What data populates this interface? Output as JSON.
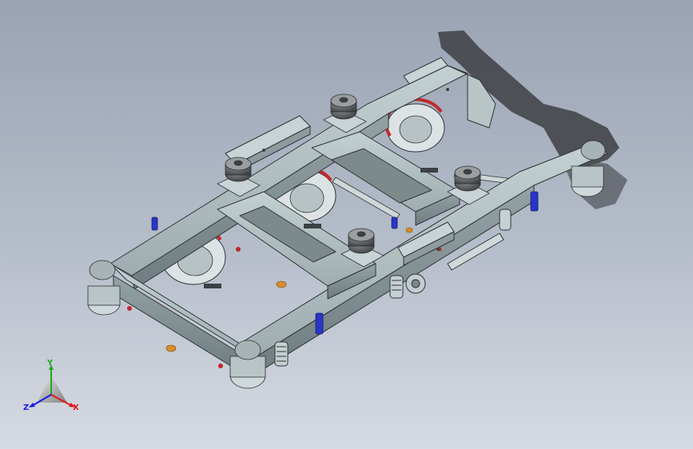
{
  "viewport": {
    "background_top": "#9aa3b4",
    "background_bottom": "#d6dae2",
    "model": "bogie-3d-model"
  },
  "triad": {
    "x_label": "X",
    "y_label": "Y",
    "z_label": "Z",
    "x_color": "#e01818",
    "y_color": "#1fa81f",
    "z_color": "#1a1ae0"
  },
  "colors": {
    "frame": "#aebdbf",
    "frame_shade": "#8a999c",
    "frame_dark": "#6c7a7d",
    "edge": "#2f3437",
    "shadow": "#3e4044",
    "wheel_red": "#c0282a",
    "damper_blue": "#2a34c8",
    "pad_orange": "#d98c2a",
    "rubber": "#585c5e"
  }
}
